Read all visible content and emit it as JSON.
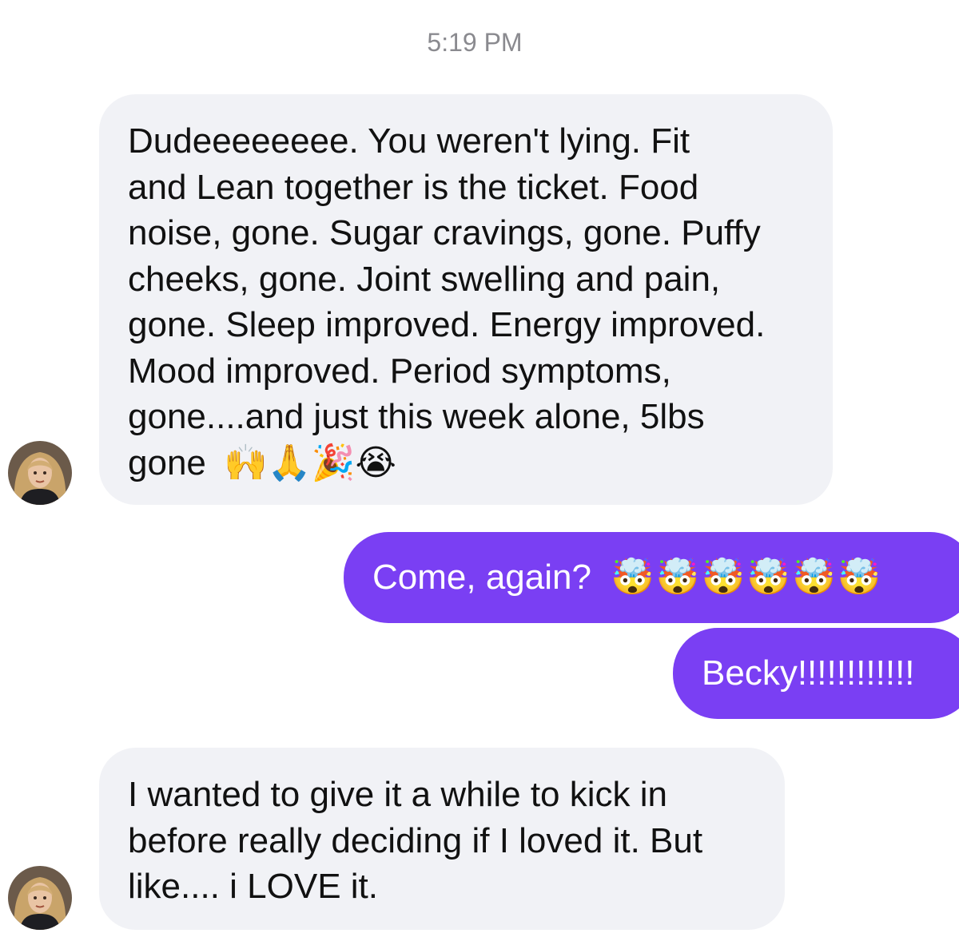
{
  "timestamp": "5:19 PM",
  "messages": [
    {
      "sender": "contact",
      "lines": [
        "Dudeeeeeeee.  You weren't lying.  Fit",
        "and Lean together is the ticket.  Food",
        "noise, gone. Sugar cravings, gone. Puffy",
        "cheeks, gone. Joint swelling and pain,",
        "gone. Sleep improved. Energy improved.",
        "Mood improved. Period symptoms,",
        "gone....and just this week alone, 5lbs",
        "gone"
      ],
      "emojis": "🙌🙏🎉😭"
    },
    {
      "sender": "me",
      "text": "Come, again?",
      "emojis": "🤯🤯🤯🤯🤯🤯"
    },
    {
      "sender": "me",
      "text": "Becky!!!!!!!!!!!!"
    },
    {
      "sender": "contact",
      "lines": [
        "I wanted to give it a while to kick in",
        "before really deciding if I loved it.  But",
        "like.... i LOVE it."
      ]
    }
  ],
  "colors": {
    "outgoing_bubble": "#7a3ff3",
    "incoming_bubble": "#f1f2f6",
    "timestamp_text": "#8a8a8f"
  },
  "icons": {
    "contact_avatar": "contact-avatar-photo"
  }
}
